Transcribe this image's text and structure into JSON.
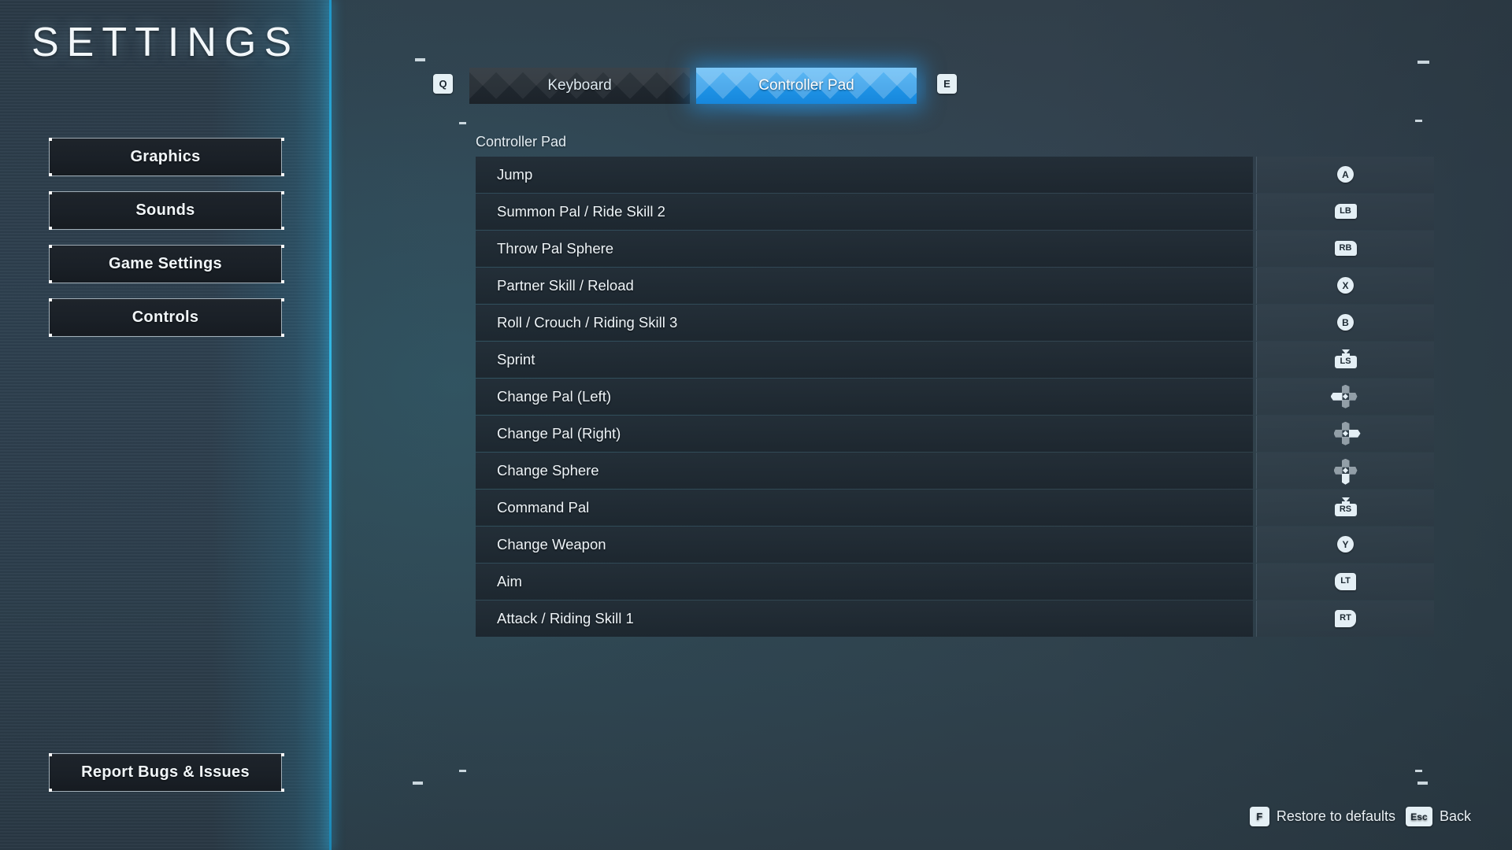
{
  "page": {
    "title": "SETTINGS",
    "accent_color": "#2aa3f2",
    "edge_color": "#2fb0dc"
  },
  "sidebar": {
    "items": [
      {
        "label": "Graphics"
      },
      {
        "label": "Sounds"
      },
      {
        "label": "Game Settings"
      },
      {
        "label": "Controls"
      }
    ],
    "report_button": "Report Bugs & Issues"
  },
  "tabs": {
    "prev_key": "Q",
    "next_key": "E",
    "items": [
      {
        "label": "Keyboard",
        "selected": false
      },
      {
        "label": "Controller Pad",
        "selected": true
      }
    ]
  },
  "main": {
    "section_label": "Controller Pad",
    "rows": [
      {
        "action": "Jump",
        "bind": "A",
        "glyph": "face-a"
      },
      {
        "action": "Summon Pal / Ride Skill 2",
        "bind": "LB",
        "glyph": "bumper-lb"
      },
      {
        "action": "Throw Pal Sphere",
        "bind": "RB",
        "glyph": "bumper-rb"
      },
      {
        "action": "Partner Skill / Reload",
        "bind": "X",
        "glyph": "face-x"
      },
      {
        "action": "Roll / Crouch / Riding Skill 3",
        "bind": "B",
        "glyph": "face-b"
      },
      {
        "action": "Sprint",
        "bind": "LS",
        "glyph": "stick-ls"
      },
      {
        "action": "Change Pal (Left)",
        "bind": "D-Pad Left",
        "glyph": "dpad-left"
      },
      {
        "action": "Change Pal (Right)",
        "bind": "D-Pad Right",
        "glyph": "dpad-right"
      },
      {
        "action": "Change Sphere",
        "bind": "D-Pad Down",
        "glyph": "dpad-down"
      },
      {
        "action": "Command Pal",
        "bind": "RS",
        "glyph": "stick-rs"
      },
      {
        "action": "Change Weapon",
        "bind": "Y",
        "glyph": "face-y"
      },
      {
        "action": "Aim",
        "bind": "LT",
        "glyph": "trigger-lt"
      },
      {
        "action": "Attack / Riding Skill 1",
        "bind": "RT",
        "glyph": "trigger-rt"
      }
    ]
  },
  "footer": {
    "restore_key": "F",
    "restore_label": "Restore to defaults",
    "back_key": "Esc",
    "back_label": "Back"
  }
}
